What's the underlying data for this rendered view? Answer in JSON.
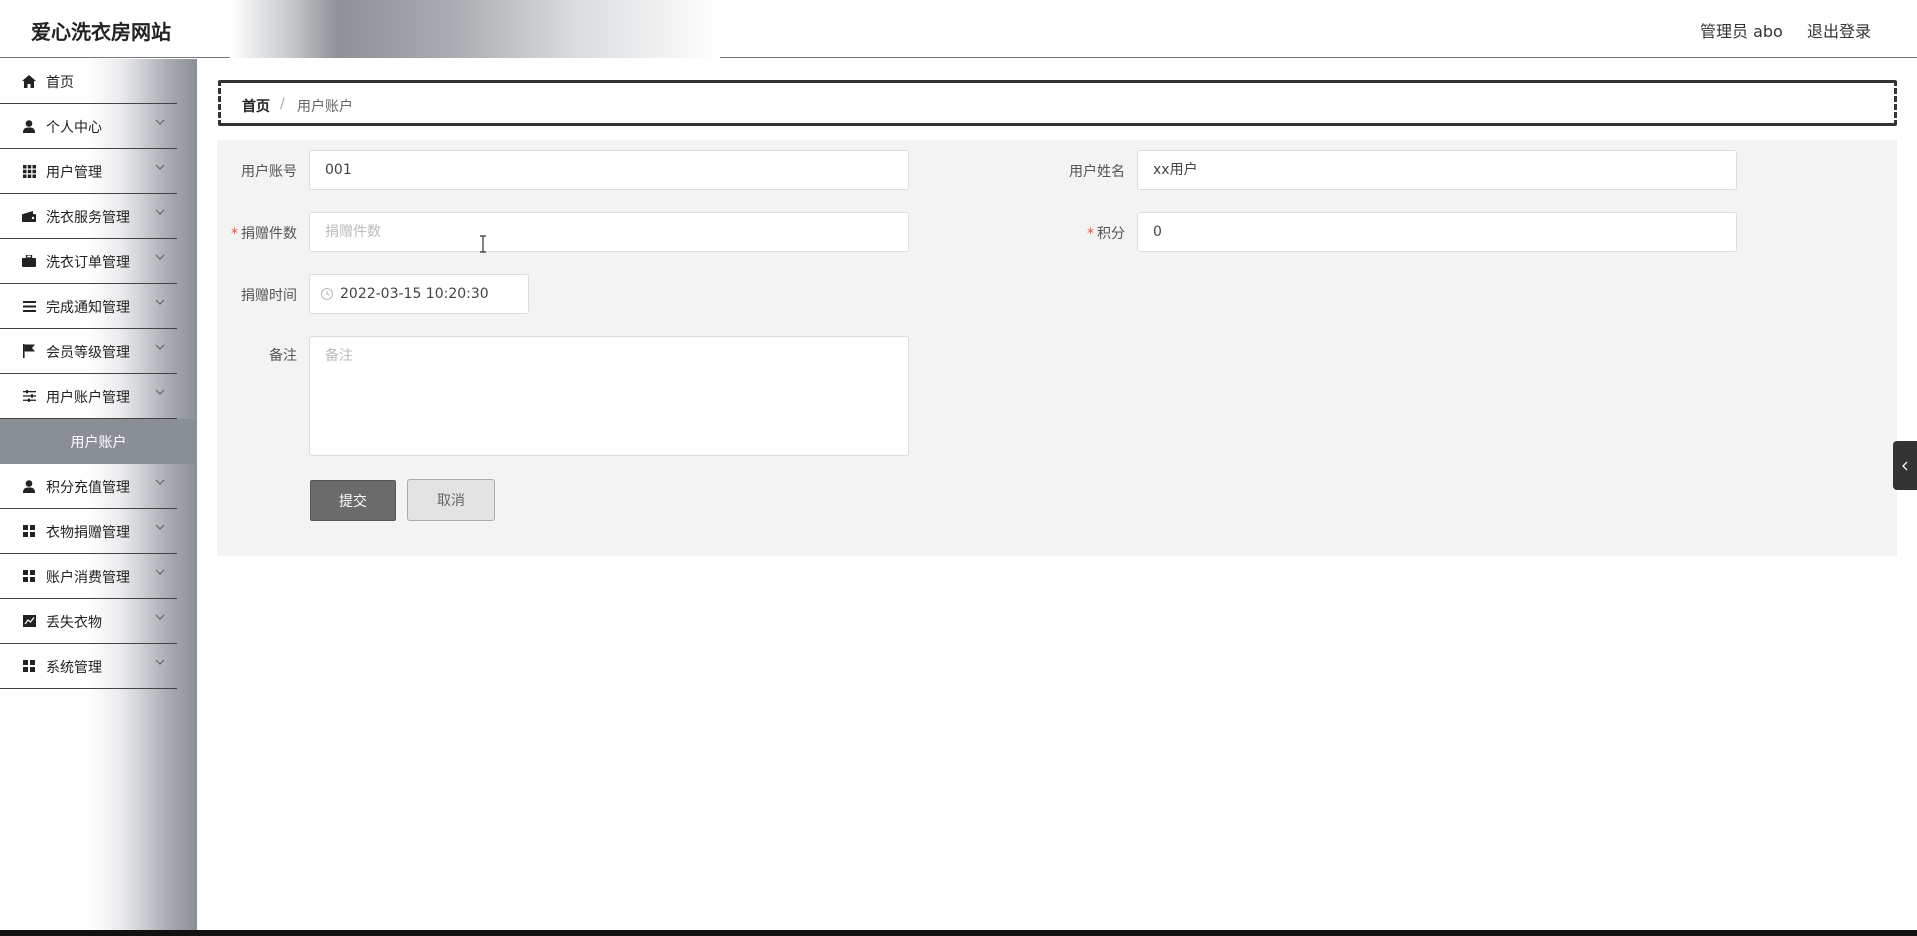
{
  "header": {
    "brand": "爱心洗衣房网站",
    "user": "管理员 abo",
    "logout": "退出登录"
  },
  "sidebar": {
    "items": [
      {
        "label": "首页",
        "icon": "home-icon"
      },
      {
        "label": "个人中心",
        "icon": "person-icon"
      },
      {
        "label": "用户管理",
        "icon": "grid-icon"
      },
      {
        "label": "洗衣服务管理",
        "icon": "wallet-icon"
      },
      {
        "label": "洗衣订单管理",
        "icon": "briefcase-icon"
      },
      {
        "label": "完成通知管理",
        "icon": "list-icon"
      },
      {
        "label": "会员等级管理",
        "icon": "flag-icon"
      },
      {
        "label": "用户账户管理",
        "icon": "sliders-icon"
      },
      {
        "label": "积分充值管理",
        "icon": "person-icon"
      },
      {
        "label": "衣物捐赠管理",
        "icon": "dashboard-icon"
      },
      {
        "label": "账户消费管理",
        "icon": "dashboard-icon"
      },
      {
        "label": "丢失衣物",
        "icon": "chart-icon"
      },
      {
        "label": "系统管理",
        "icon": "dashboard-icon"
      }
    ],
    "active_subitem": "用户账户"
  },
  "breadcrumb": {
    "home": "首页",
    "separator": "/",
    "current": "用户账户"
  },
  "form": {
    "account_label": "用户账号",
    "account_value": "001",
    "name_label": "用户姓名",
    "name_value": "xx用户",
    "donate_count_label": "捐赠件数",
    "donate_count_placeholder": "捐赠件数",
    "points_label": "积分",
    "points_value": "0",
    "donate_time_label": "捐赠时间",
    "donate_time_value": "2022-03-15 10:20:30",
    "remark_label": "备注",
    "remark_placeholder": "备注",
    "required_mark": "*",
    "submit": "提交",
    "cancel": "取消"
  },
  "colors": {
    "submit_bg": "#6b6b6b",
    "panel_bg": "#f3f3f3",
    "required": "#e5564d",
    "active_menu_bg": "#8a8f96"
  }
}
